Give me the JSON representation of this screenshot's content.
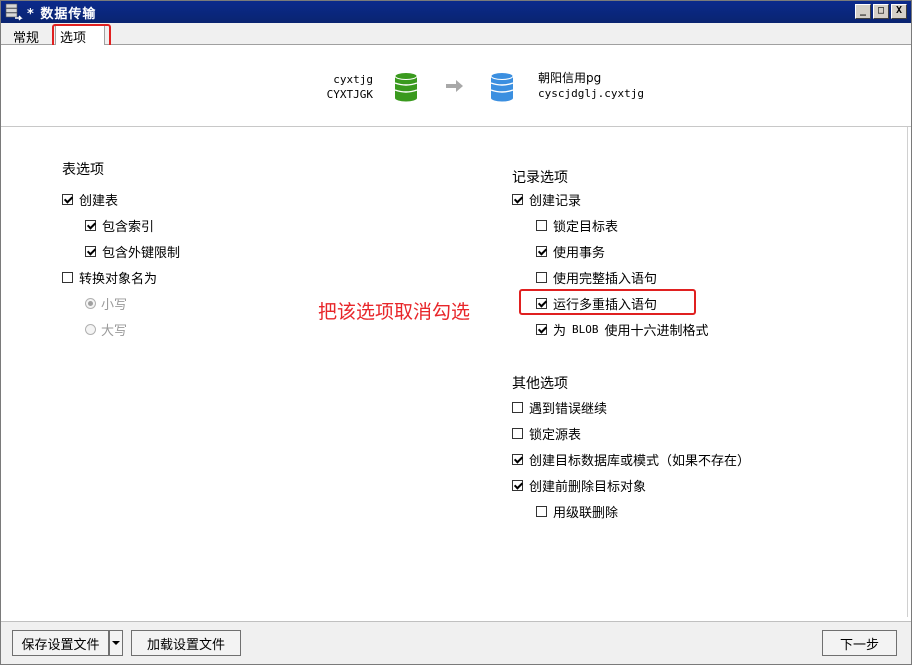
{
  "window": {
    "title": "* 数据传输",
    "controls": {
      "minimize": "_",
      "restore": "□",
      "close": "X"
    }
  },
  "tabs": [
    {
      "label": "常规",
      "active": false
    },
    {
      "label": "选项",
      "active": true
    }
  ],
  "transfer": {
    "source": {
      "line1": "cyxtjg",
      "line2": "CYXTJGK"
    },
    "target": {
      "line1": "朝阳信用pg",
      "line2": "cyscjdglj.cyxtjg"
    },
    "db_icon_colors": {
      "source": "#3a9a1e",
      "target": "#3b8fe0"
    }
  },
  "table_options": {
    "title": "表选项",
    "create_table": {
      "label": "创建表",
      "checked": true
    },
    "include_index": {
      "label": "包含索引",
      "checked": true
    },
    "include_fk": {
      "label": "包含外键限制",
      "checked": true
    },
    "convert_name": {
      "label": "转换对象名为",
      "checked": false
    },
    "lowercase": {
      "label": "小写",
      "selected": true,
      "enabled": false
    },
    "uppercase": {
      "label": "大写",
      "selected": false,
      "enabled": false
    }
  },
  "record_options": {
    "title": "记录选项",
    "create_record": {
      "label": "创建记录",
      "checked": true
    },
    "lock_target": {
      "label": "锁定目标表",
      "checked": false
    },
    "use_transaction": {
      "label": "使用事务",
      "checked": true
    },
    "complete_insert": {
      "label": "使用完整插入语句",
      "checked": false
    },
    "multi_insert": {
      "label": "运行多重插入语句",
      "checked": true
    },
    "blob_hex": {
      "prefix": "为",
      "blob": "BLOB",
      "suffix": "使用十六进制格式",
      "checked": true
    }
  },
  "other_options": {
    "title": "其他选项",
    "continue_on_error": {
      "label": "遇到错误继续",
      "checked": false
    },
    "lock_source": {
      "label": "锁定源表",
      "checked": false
    },
    "create_target_db": {
      "label": "创建目标数据库或模式（如果不存在）",
      "checked": true
    },
    "drop_before_create": {
      "label": "创建前删除目标对象",
      "checked": true
    },
    "cascade_delete": {
      "label": "用级联删除",
      "checked": false
    }
  },
  "annotation": {
    "text": "把该选项取消勾选",
    "color": "#e8262a"
  },
  "footer": {
    "save_label": "保存设置文件",
    "load_label": "加载设置文件",
    "next_label": "下一步"
  }
}
